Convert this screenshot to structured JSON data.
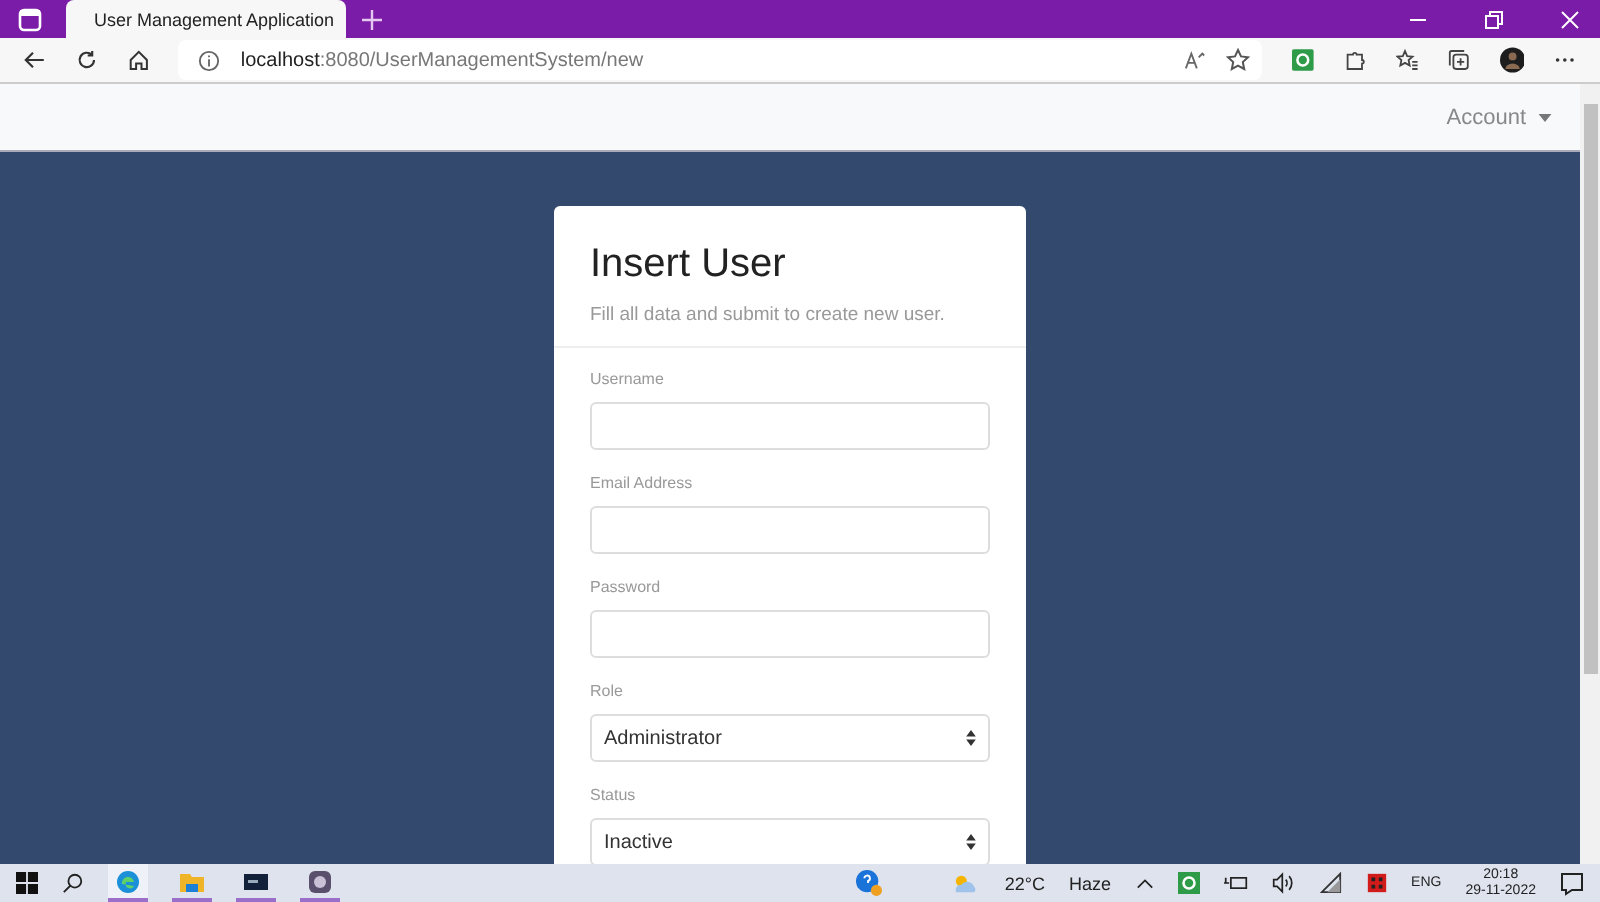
{
  "browser": {
    "tab_title": "User Management Application",
    "url_host": "localhost",
    "url_path": ":8080/UserManagementSystem/new"
  },
  "navbar": {
    "account": "Account"
  },
  "card": {
    "title": "Insert User",
    "subtitle": "Fill all data and submit to create new user.",
    "fields": [
      {
        "kind": "text",
        "label": "Username"
      },
      {
        "kind": "text",
        "label": "Email Address"
      },
      {
        "kind": "password",
        "label": "Password"
      },
      {
        "kind": "select",
        "label": "Role",
        "value": "Administrator"
      },
      {
        "kind": "select",
        "label": "Status",
        "value": "Inactive"
      }
    ]
  },
  "taskbar": {
    "apps": [
      {
        "kind": "browser",
        "selected": true
      },
      {
        "kind": "folder",
        "selected": false
      },
      {
        "kind": "terminal",
        "selected": false
      },
      {
        "kind": "app",
        "selected": false
      }
    ],
    "temperature": "22°C",
    "weather": "Haze",
    "language": "ENG",
    "time": "20:18",
    "date": "29-11-2022"
  }
}
